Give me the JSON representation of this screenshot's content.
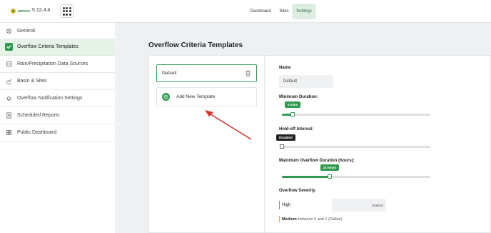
{
  "header": {
    "logo_text": "amiers",
    "version": "5.12.4.4",
    "nav": [
      {
        "label": "Dashboard"
      },
      {
        "label": "Sites"
      },
      {
        "label": "Settings"
      }
    ]
  },
  "sidebar": {
    "items": [
      {
        "label": "General",
        "icon": "gear-icon"
      },
      {
        "label": "Overflow Criteria Templates",
        "icon": "check-icon",
        "active": true
      },
      {
        "label": "Rain/Precipitation Data Sources",
        "icon": "rain-icon"
      },
      {
        "label": "Basin & Sites",
        "icon": "chart-icon"
      },
      {
        "label": "Overflow Notification Settings",
        "icon": "bell-icon"
      },
      {
        "label": "Scheduled Reports",
        "icon": "report-icon"
      },
      {
        "label": "Public Dashboard",
        "icon": "grid-icon"
      }
    ]
  },
  "main": {
    "title": "Overflow Criteria Templates",
    "templates": [
      {
        "label": "Default",
        "icon": "trash-icon"
      }
    ],
    "add_template_label": "Add New Template",
    "form": {
      "name_label": "Name",
      "name_value": "Default",
      "min_duration_label": "Minimum Duration:",
      "min_duration_value": "5 mins",
      "min_duration_fraction": 0.07,
      "holdoff_label": "Hold-off Interval:",
      "holdoff_value": "Disabled",
      "holdoff_fraction": 0.0,
      "max_overflow_label": "Maximum Overflow Duration (hours):",
      "max_overflow_value": "24 hours",
      "max_overflow_fraction": 0.32,
      "severity_label": "Overflow Severity",
      "severity_high_label": "High",
      "severity_high_arrow": ">",
      "severity_high_unit": "(Gallon)",
      "severity_medium_label": "Medium",
      "severity_medium_text": "between 0 and 1 (Gallon)"
    },
    "colors": {
      "accent": "#2e9a4f",
      "medium": "#e0b11a",
      "arrow": "#d9302a"
    }
  }
}
